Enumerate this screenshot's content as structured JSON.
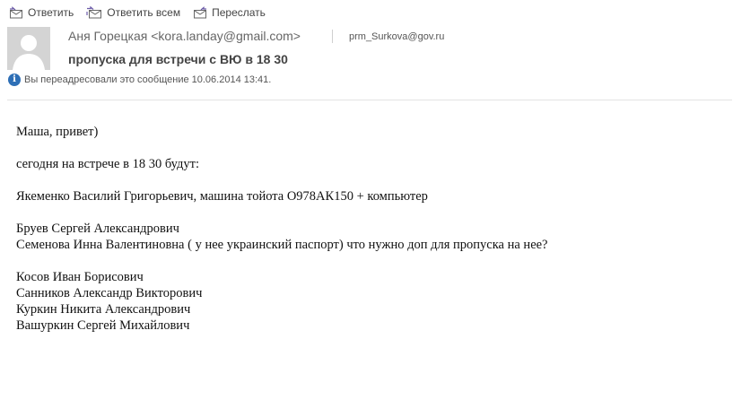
{
  "toolbar": {
    "reply_label": "Ответить",
    "reply_all_label": "Ответить всем",
    "forward_label": "Переслать"
  },
  "header": {
    "sender": "Аня Горецкая <kora.landay@gmail.com>",
    "recipient": "prm_Surkova@gov.ru",
    "subject": "пропуска для встречи с ВЮ в 18 30",
    "forward_notice": "Вы переадресовали это сообщение 10.06.2014 13:41."
  },
  "body": {
    "greeting": "Маша, привет)",
    "intro": "сегодня на встрече в 18 30 будут:",
    "line_1": "Якеменко Василий Григорьевич, машина тойота О978АК150 + компьютер",
    "line_2": "Бруев Сергей Александрович",
    "line_3": "Семенова Инна Валентиновна ( у нее украинский паспорт) что нужно доп для пропуска на нее?",
    "line_4": "Косов Иван Борисович",
    "line_5": "Санников Александр Викторович",
    "line_6": "Куркин Никита Александрович",
    "line_7": "Вашуркин Сергей Михайлович"
  },
  "icons": {
    "reply": "reply-icon",
    "reply_all": "reply-all-icon",
    "forward": "forward-icon",
    "info": "info-icon",
    "avatar": "avatar-placeholder"
  },
  "colors": {
    "info_icon": "#2e6fb6",
    "avatar_bg": "#d4d4d4",
    "icon_accent": "#6b5aa8"
  }
}
